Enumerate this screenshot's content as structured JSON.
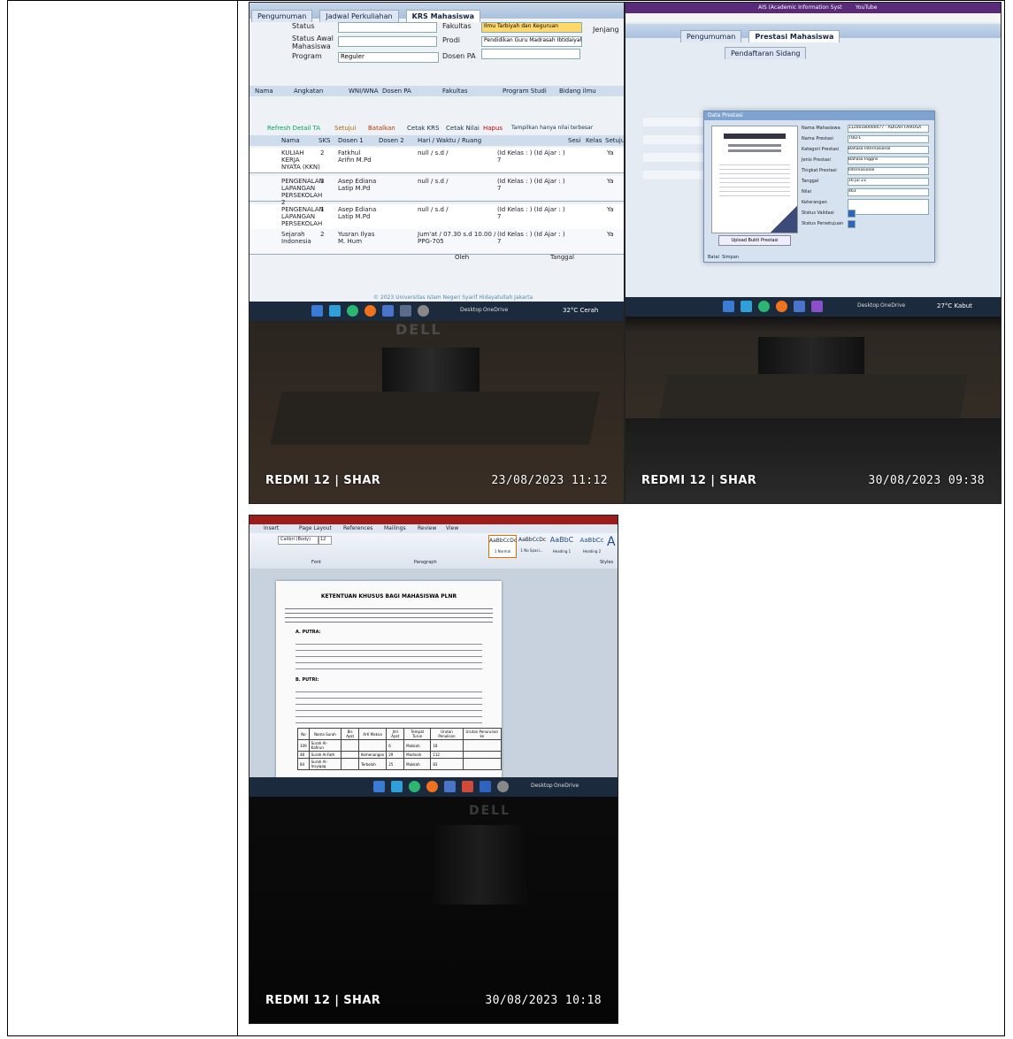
{
  "photo1": {
    "tabs": [
      "Pengumuman",
      "Jadwal Perkuliahan",
      "KRS Mahasiswa"
    ],
    "form_labels": [
      "Status",
      "Status Awal Mahasiswa",
      "Program",
      "Fakultas",
      "Prodi",
      "Dosen PA",
      "Jenjang"
    ],
    "program_value": "Reguler",
    "fakultas_value": "Ilmu Tarbiyah dan Keguruan",
    "prodi_value": "Pendidikan Guru Madrasah Ibtidaiyah",
    "grid_headers": [
      "Nama",
      "Angkatan",
      "WNI/WNA",
      "Dosen PA",
      "Fakultas",
      "Program Studi",
      "Bidang ilmu"
    ],
    "toolbar": [
      "Refresh Detail TA",
      "Setujui",
      "Batalkan",
      "Cetak KRS",
      "Cetak Nilai",
      "Hapus",
      "Tampilkan hanya nilai terbesar"
    ],
    "course_headers": [
      "Nama",
      "SKS",
      "Dosen 1",
      "Dosen 2",
      "Hari / Waktu / Ruang",
      "Sesi",
      "Kelas",
      "Setuju"
    ],
    "courses": [
      {
        "nama": "KULIAH KERJA NYATA (KKN)",
        "sks": "2",
        "dosen": "Fatkhul Arifin M.Pd",
        "waktu": "null / s.d /",
        "kelas": "(Id Kelas : ) (Id Ajar : ) 7",
        "setuju": "Ya"
      },
      {
        "nama": "PENGENALAN LAPANGAN PERSEKOLAH 2",
        "sks": "3",
        "dosen": "Asep Ediana Latip M.Pd",
        "waktu": "null / s.d /",
        "kelas": "(Id Kelas : ) (Id Ajar : ) 7",
        "setuju": "Ya"
      },
      {
        "nama": "PENGENALAN LAPANGAN PERSEKOLAH",
        "sks": "1",
        "dosen": "Asep Ediana Latip M.Pd",
        "waktu": "null / s.d /",
        "kelas": "(Id Kelas : ) (Id Ajar : ) 7",
        "setuju": "Ya"
      },
      {
        "nama": "Sejarah Indonesia",
        "sks": "2",
        "dosen": "Yusran Ilyas M. Hum",
        "waktu": "Jum'at / 07.30 s.d 10.00 / PPG-705",
        "kelas": "(Id Kelas : ) (Id Ajar : ) 7",
        "setuju": "Ya"
      }
    ],
    "footer_cols": [
      "Oleh",
      "Tanggal"
    ],
    "copyright": "© 2023 Universitas Islam Negeri Syarif Hidayatullah Jakarta",
    "weather": "32°C Cerah",
    "taskbar_label": "Desktop",
    "taskbar_app": "OneDrive",
    "monitor_brand": "DELL",
    "stamp_brand": "REDMI 12 | SHAR",
    "stamp_date": "23/08/2023  11:12"
  },
  "photo2": {
    "tabs": [
      "Pengumuman",
      "Prestasi Mahasiswa",
      "Pendaftaran Sidang"
    ],
    "browser_tabs": [
      "AIS (Academic Information Syst",
      "YouTube"
    ],
    "dialog_title": "Data Prestasi",
    "fields": [
      {
        "label": "Nama Mahasiswa",
        "value": "11200180000077 - ADILAH FAIROSA"
      },
      {
        "label": "Nama Prestasi",
        "value": "TOEFL"
      },
      {
        "label": "Kategori Prestasi",
        "value": "Bahasa Internasional"
      },
      {
        "label": "Jenis Prestasi",
        "value": "Bahasa Inggris"
      },
      {
        "label": "Tingkat Prestasi",
        "value": "Internasional"
      },
      {
        "label": "Tanggal",
        "value": "16 Jul 23"
      },
      {
        "label": "Nilai",
        "value": "463"
      },
      {
        "label": "Keterangan",
        "value": ""
      },
      {
        "label": "Status Validasi",
        "value": ""
      },
      {
        "label": "Status Persetujuan",
        "value": ""
      }
    ],
    "upload_button": "Upload Bukti Prestasi",
    "dialog_buttons": [
      "Batal",
      "Simpan"
    ],
    "weather": "27°C Kabut",
    "taskbar_label": "Desktop",
    "taskbar_app": "OneDrive",
    "stamp_brand": "REDMI 12 | SHAR",
    "stamp_date": "30/08/2023  09:38"
  },
  "photo3": {
    "ribbon_tabs": [
      "Insert",
      "Page Layout",
      "References",
      "Mailings",
      "Review",
      "View"
    ],
    "font_name": "Calibri (Body)",
    "font_size": "12",
    "styles": [
      "AaBbCcDc",
      "AaBbCcDc",
      "AaBbC",
      "AaBbCc",
      "A"
    ],
    "style_names": [
      "1 Normal",
      "1 No Spaci...",
      "Heading 1",
      "Heading 2"
    ],
    "group_labels": [
      "Font",
      "Paragraph",
      "Styles"
    ],
    "doc_title": "KETENTUAN KHUSUS BAGI MAHASISWA PLNR",
    "sections": [
      "A. PUTRA:",
      "B. PUTRI:"
    ],
    "table_headers": [
      "No",
      "Nama Surah",
      "Bis Ayat",
      "Arti Makna",
      "Jml Ayat",
      "Tempat Turun",
      "Urutan Penulisan",
      "Urutan Penurunan ke"
    ],
    "table_rows": [
      [
        "109",
        "Surah Al-Kafirun",
        "",
        "",
        "6",
        "Makkah",
        "18"
      ],
      [
        "48",
        "Surah Al-Fath",
        "",
        "Kemenangan",
        "29",
        "Madinah",
        "112"
      ],
      [
        "84",
        "Surah Al-Insyiqaq",
        "",
        "Terbelah",
        "25",
        "Makkah",
        "83"
      ]
    ],
    "taskbar_label": "Desktop",
    "taskbar_app": "OneDrive",
    "monitor_brand": "DELL",
    "stamp_brand": "REDMI 12 | SHAR",
    "stamp_date": "30/08/2023  10:18"
  }
}
